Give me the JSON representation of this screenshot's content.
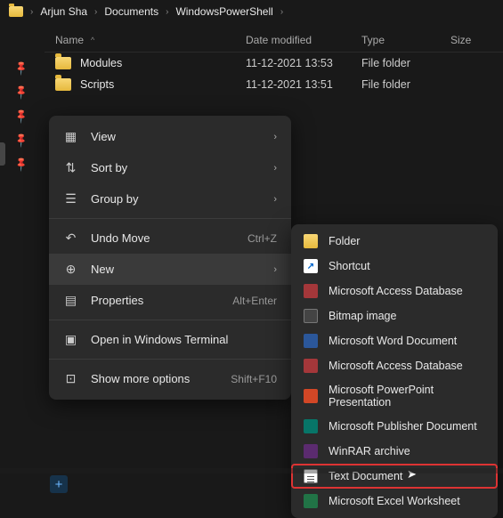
{
  "breadcrumb": [
    "Arjun Sha",
    "Documents",
    "WindowsPowerShell"
  ],
  "columns": {
    "name": "Name",
    "date": "Date modified",
    "type": "Type",
    "size": "Size"
  },
  "rows": [
    {
      "name": "Modules",
      "date": "11-12-2021 13:53",
      "type": "File folder"
    },
    {
      "name": "Scripts",
      "date": "11-12-2021 13:51",
      "type": "File folder"
    }
  ],
  "context_menu": {
    "view": "View",
    "sort_by": "Sort by",
    "group_by": "Group by",
    "undo_move": "Undo Move",
    "undo_shortcut": "Ctrl+Z",
    "new": "New",
    "properties": "Properties",
    "properties_shortcut": "Alt+Enter",
    "open_terminal": "Open in Windows Terminal",
    "show_more": "Show more options",
    "show_more_shortcut": "Shift+F10"
  },
  "new_submenu": [
    {
      "label": "Folder",
      "cls": "fold"
    },
    {
      "label": "Shortcut",
      "cls": "short"
    },
    {
      "label": "Microsoft Access Database",
      "cls": "acc"
    },
    {
      "label": "Bitmap image",
      "cls": "bmp"
    },
    {
      "label": "Microsoft Word Document",
      "cls": "word"
    },
    {
      "label": "Microsoft Access Database",
      "cls": "acc"
    },
    {
      "label": "Microsoft PowerPoint Presentation",
      "cls": "ppt"
    },
    {
      "label": "Microsoft Publisher Document",
      "cls": "pub"
    },
    {
      "label": "WinRAR archive",
      "cls": "rar"
    },
    {
      "label": "Text Document",
      "cls": "txt",
      "highlight": true
    },
    {
      "label": "Microsoft Excel Worksheet",
      "cls": "xls"
    }
  ]
}
